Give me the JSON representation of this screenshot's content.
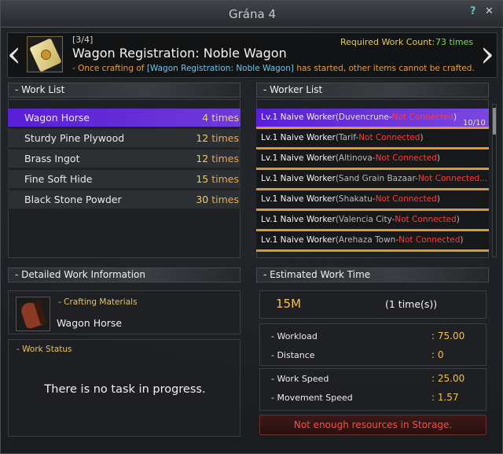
{
  "window": {
    "title": "Grána 4",
    "help_icon": "?",
    "close_icon": "✕"
  },
  "header": {
    "step": "[3/4]",
    "title": "Wagon Registration: Noble Wagon",
    "required_label": "Required Work Count:",
    "required_value": "73 times",
    "notice_prefix": "- Once crafting of ",
    "notice_highlight": "[Wagon Registration: Noble Wagon]",
    "notice_suffix": " has started, other items cannot be crafted."
  },
  "work_list": {
    "heading": "- Work List",
    "items": [
      {
        "name": "Wagon Horse",
        "count": "4",
        "unit": "times",
        "selected": true
      },
      {
        "name": "Sturdy Pine Plywood",
        "count": "12",
        "unit": "times",
        "selected": false
      },
      {
        "name": "Brass Ingot",
        "count": "12",
        "unit": "times",
        "selected": false
      },
      {
        "name": "Fine Soft Hide",
        "count": "15",
        "unit": "times",
        "selected": false
      },
      {
        "name": "Black Stone Powder",
        "count": "30",
        "unit": "times",
        "selected": false
      }
    ]
  },
  "worker_list": {
    "heading": "- Worker List",
    "count": "10/10",
    "workers": [
      {
        "level": "Lv.1 Naive Worker",
        "location": "(Duvencrune-",
        "status": "Not Connected",
        "close": ")"
      },
      {
        "level": "Lv.1 Naive Worker",
        "location": "(Tarif-",
        "status": "Not Connected",
        "close": ")"
      },
      {
        "level": "Lv.1 Naive Worker",
        "location": "(Altinova-",
        "status": "Not Connected",
        "close": ")"
      },
      {
        "level": "Lv.1 Naive Worker",
        "location": "(Sand Grain Bazaar-",
        "status": "Not Connected...",
        "close": ""
      },
      {
        "level": "Lv.1 Naive Worker",
        "location": "(Shakatu-",
        "status": "Not Connected",
        "close": ")"
      },
      {
        "level": "Lv.1 Naive Worker",
        "location": "(Valencia City-",
        "status": "Not Connected",
        "close": ")"
      },
      {
        "level": "Lv.1 Naive Worker",
        "location": "(Arehaza Town-",
        "status": "Not Connected",
        "close": ")"
      }
    ]
  },
  "detail": {
    "heading": "- Detailed Work Information",
    "materials_label": "- Crafting Materials",
    "material_name": "Wagon Horse",
    "status_label": "- Work Status",
    "status_text": "There is no task in progress."
  },
  "estimate": {
    "heading": "- Estimated Work Time",
    "time": "15M",
    "times": "(1 time(s))",
    "stats": [
      {
        "label": "- Workload",
        "value": ": 75.00"
      },
      {
        "label": "- Distance",
        "value": ": 0"
      },
      {
        "label": "- Work Speed",
        "value": ": 25.00"
      },
      {
        "label": "- Movement Speed",
        "value": ": 1.57"
      }
    ],
    "warning": "Not enough resources in Storage."
  }
}
